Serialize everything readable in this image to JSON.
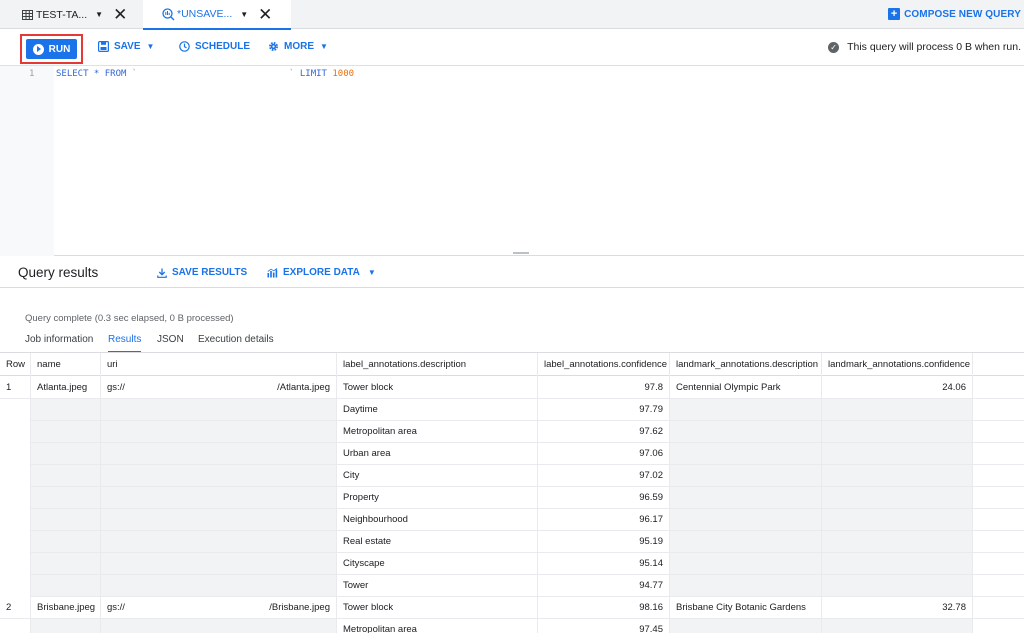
{
  "tabs": [
    {
      "label": "TEST-TA...",
      "icon": "table-icon"
    },
    {
      "label": "*UNSAVE...",
      "icon": "query-icon"
    }
  ],
  "compose_label": "COMPOSE NEW QUERY",
  "toolbar": {
    "run_label": "RUN",
    "save_label": "SAVE",
    "schedule_label": "SCHEDULE",
    "more_label": "MORE",
    "status_text": "This query will process 0 B when run."
  },
  "editor": {
    "line_number": "1",
    "select_kw": "SELECT * FROM",
    "table_ref": "`                            `",
    "limit_kw": "LIMIT",
    "limit_value": "1000"
  },
  "results": {
    "title": "Query results",
    "save_results_label": "SAVE RESULTS",
    "explore_label": "EXPLORE DATA",
    "status": "Query complete (0.3 sec elapsed, 0 B processed)",
    "subtabs": [
      "Job information",
      "Results",
      "JSON",
      "Execution details"
    ],
    "columns": [
      "Row",
      "name",
      "uri",
      "label_annotations.description",
      "label_annotations.confidence",
      "landmark_annotations.description",
      "landmark_annotations.confidence"
    ],
    "records": [
      {
        "row": "1",
        "name": "Atlanta.jpeg",
        "uri_prefix": "gs://",
        "uri_suffix": "/Atlanta.jpeg",
        "labels": [
          {
            "description": "Tower block",
            "confidence": "97.8"
          },
          {
            "description": "Daytime",
            "confidence": "97.79"
          },
          {
            "description": "Metropolitan area",
            "confidence": "97.62"
          },
          {
            "description": "Urban area",
            "confidence": "97.06"
          },
          {
            "description": "City",
            "confidence": "97.02"
          },
          {
            "description": "Property",
            "confidence": "96.59"
          },
          {
            "description": "Neighbourhood",
            "confidence": "96.17"
          },
          {
            "description": "Real estate",
            "confidence": "95.19"
          },
          {
            "description": "Cityscape",
            "confidence": "95.14"
          },
          {
            "description": "Tower",
            "confidence": "94.77"
          }
        ],
        "landmark_description": "Centennial Olympic Park",
        "landmark_confidence": "24.06"
      },
      {
        "row": "2",
        "name": "Brisbane.jpeg",
        "uri_prefix": "gs://",
        "uri_suffix": "/Brisbane.jpeg",
        "labels": [
          {
            "description": "Tower block",
            "confidence": "98.16"
          },
          {
            "description": "Metropolitan area",
            "confidence": "97.45"
          }
        ],
        "landmark_description": "Brisbane City Botanic Gardens",
        "landmark_confidence": "32.78"
      }
    ]
  }
}
